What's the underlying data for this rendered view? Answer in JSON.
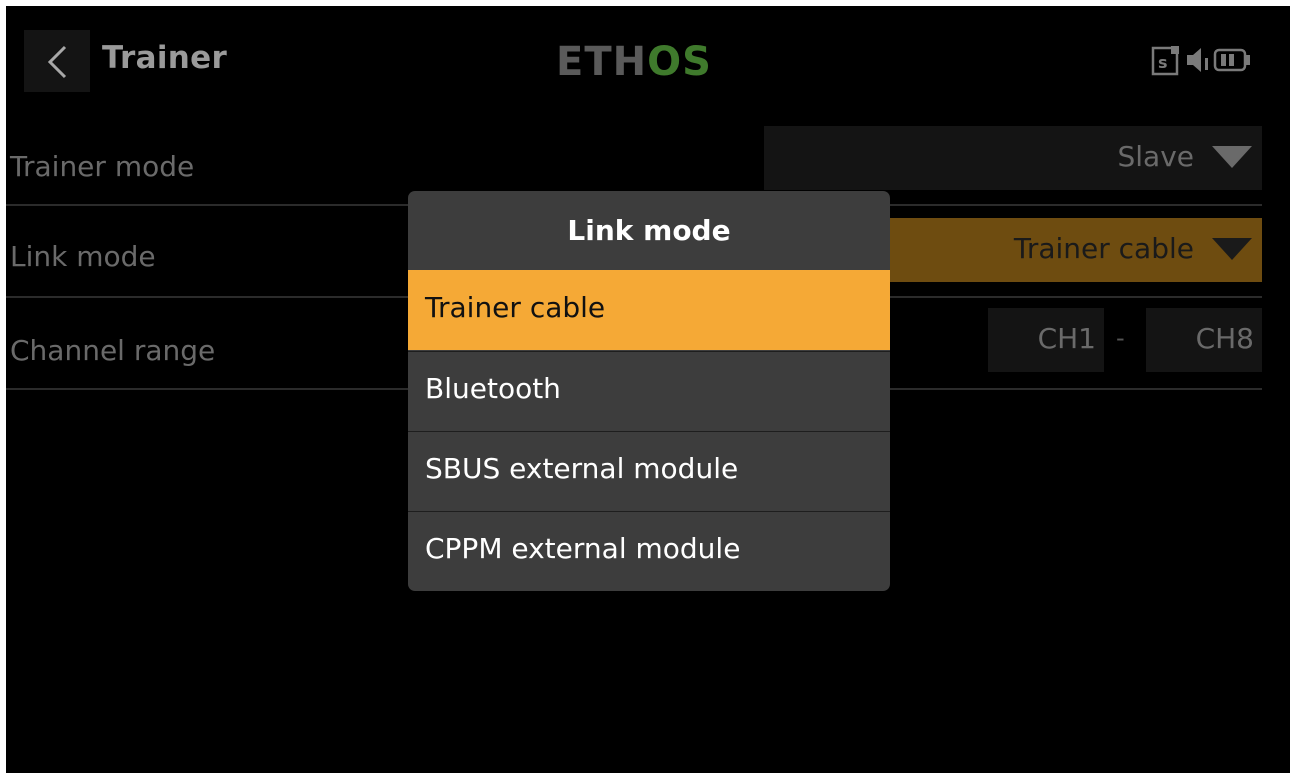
{
  "header": {
    "title": "Trainer",
    "logo_left": "ETH",
    "logo_right": "OS",
    "icons": [
      "back-chevron-icon",
      "sd-card-icon",
      "speaker-icon",
      "battery-icon"
    ]
  },
  "settings": {
    "trainer_mode": {
      "label": "Trainer mode",
      "value": "Slave"
    },
    "link_mode": {
      "label": "Link mode",
      "value": "Trainer cable"
    },
    "channel_range": {
      "label": "Channel range",
      "from": "CH1",
      "separator": "-",
      "to": "CH8"
    }
  },
  "popup": {
    "title": "Link mode",
    "options": [
      "Trainer cable",
      "Bluetooth",
      "SBUS external module",
      "CPPM external module"
    ],
    "selected": "Trainer cable"
  },
  "colors": {
    "accent": "#f5a936",
    "accent_dim": "#6e4c10",
    "logo_green": "#3f7a2c",
    "popup_bg": "#3d3d3d"
  }
}
